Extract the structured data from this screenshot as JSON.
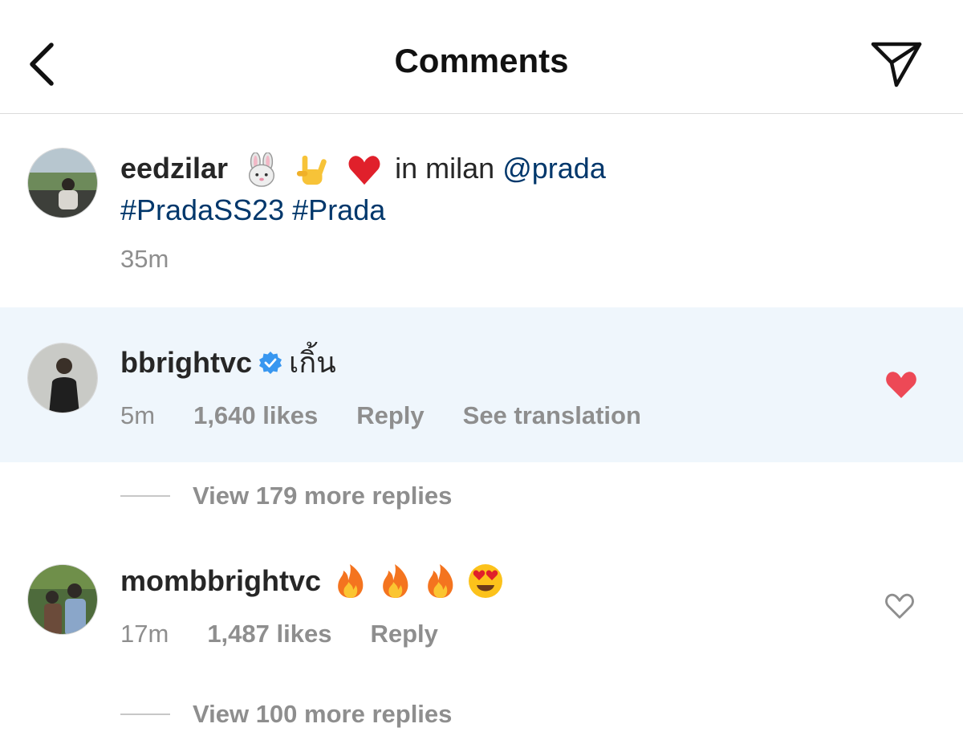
{
  "header": {
    "title": "Comments",
    "back_icon": "chevron-left-icon",
    "send_icon": "paper-plane-icon"
  },
  "caption": {
    "username": "eedzilar",
    "emojis": [
      "rabbit-face",
      "sign-of-the-horns",
      "red-heart"
    ],
    "text": "in milan",
    "mention": "@prada",
    "hashtags": "#PradaSS23 #Prada",
    "time": "35m"
  },
  "comments": [
    {
      "username": "bbrightvc",
      "verified": true,
      "text": "เกิ้น",
      "time": "5m",
      "likes": "1,640 likes",
      "reply": "Reply",
      "translate": "See translation",
      "liked": true,
      "view_replies": "View 179 more replies"
    },
    {
      "username": "mombbrightvc",
      "emojis": [
        "fire",
        "fire",
        "fire",
        "heart-eyes"
      ],
      "time": "17m",
      "likes": "1,487 likes",
      "reply": "Reply",
      "liked": false,
      "view_replies": "View 100 more replies"
    }
  ],
  "colors": {
    "link": "#00376b",
    "muted": "#8e8e8e",
    "highlight_bg": "#eff6fc",
    "like_red": "#ed4956",
    "verified_blue": "#3897f0"
  }
}
